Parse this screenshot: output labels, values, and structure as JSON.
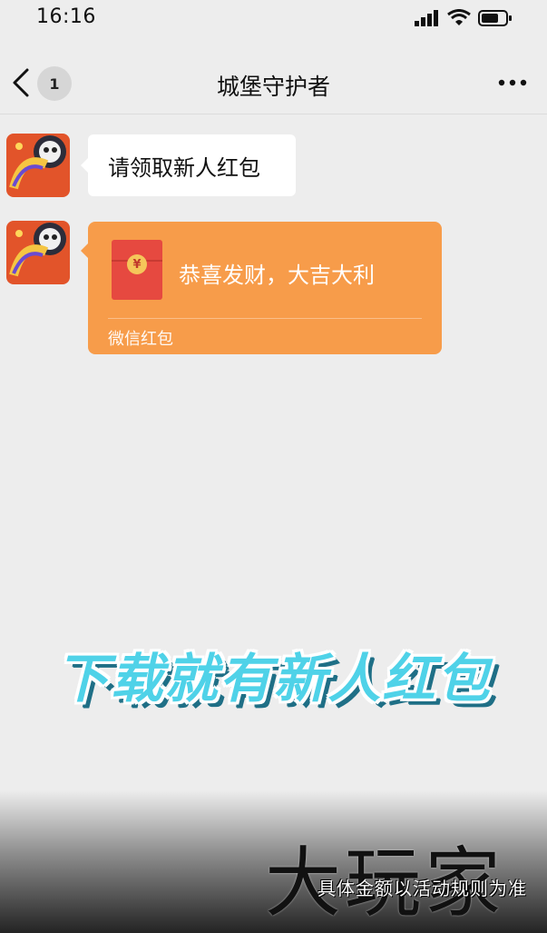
{
  "status_bar": {
    "time": "16:16",
    "icons": [
      "signal-icon",
      "wifi-icon",
      "battery-icon"
    ]
  },
  "nav": {
    "back_icon": "chevron-left-icon",
    "unread_count": "1",
    "title": "城堡守护者",
    "more_icon": "more-dots-icon"
  },
  "messages": [
    {
      "type": "text",
      "text": "请领取新人红包"
    },
    {
      "type": "red_packet",
      "coin_symbol": "¥",
      "message": "恭喜发财，大吉大利",
      "footer": "微信红包"
    }
  ],
  "overlay": {
    "promo_text": "下载就有新人红包",
    "watermark": "大玩家",
    "disclaimer": "具体金额以活动规则为准"
  },
  "colors": {
    "background": "#ededed",
    "red_packet": "#f79c4a",
    "envelope": "#e64940",
    "promo_text": "#4fd2e8"
  }
}
